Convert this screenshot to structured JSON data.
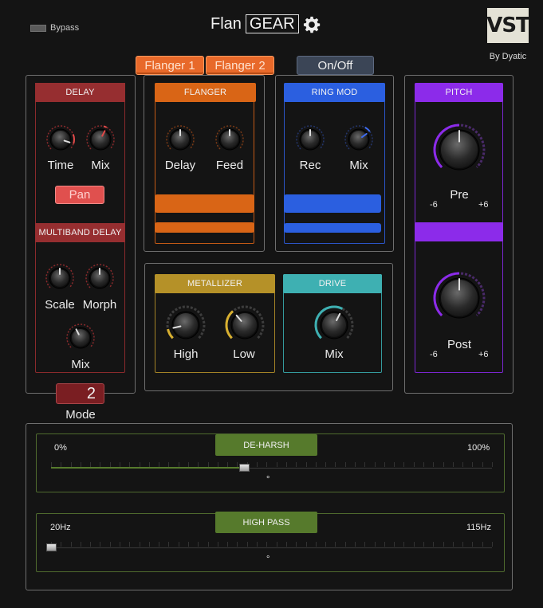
{
  "header": {
    "bypass_label": "Bypass",
    "title_plain": "Flan",
    "title_boxed": "GEAR",
    "logo_text": "VST",
    "by_label": "By Dyatic"
  },
  "tabs": [
    {
      "label": "Flanger 1",
      "active": true
    },
    {
      "label": "Flanger 2",
      "active": true
    },
    {
      "label": "On/Off",
      "active": false
    }
  ],
  "delay": {
    "title": "DELAY",
    "knobs": [
      {
        "label": "Time"
      },
      {
        "label": "Mix"
      }
    ],
    "pan_label": "Pan"
  },
  "multiband": {
    "title": "MULTIBAND DELAY",
    "knobs": [
      {
        "label": "Scale"
      },
      {
        "label": "Morph"
      },
      {
        "label": "Mix"
      }
    ]
  },
  "mode": {
    "value": "2",
    "label": "Mode"
  },
  "flanger": {
    "title": "FLANGER",
    "knobs": [
      {
        "label": "Delay"
      },
      {
        "label": "Feed"
      }
    ]
  },
  "ringmod": {
    "title": "RING MOD",
    "knobs": [
      {
        "label": "Rec"
      },
      {
        "label": "Mix"
      }
    ]
  },
  "pitch": {
    "title": "PITCH",
    "pre": {
      "label": "Pre",
      "min": "-6",
      "max": "+6"
    },
    "post": {
      "label": "Post",
      "min": "-6",
      "max": "+6"
    }
  },
  "metallizer": {
    "title": "METALLIZER",
    "knobs": [
      {
        "label": "High"
      },
      {
        "label": "Low"
      }
    ]
  },
  "drive": {
    "title": "DRIVE",
    "knobs": [
      {
        "label": "Mix"
      }
    ]
  },
  "deharsh": {
    "title": "DE-HARSH",
    "min_label": "0%",
    "max_label": "100%",
    "value_label": "°",
    "fraction": 0.44
  },
  "highpass": {
    "title": "HIGH PASS",
    "min_label": "20Hz",
    "max_label": "115Hz",
    "value_label": "°",
    "fraction": 0.0
  },
  "colors": {
    "delay": "#962e30",
    "flanger": "#d96516",
    "ringmod": "#2b5fe0",
    "pitch": "#8c2bea",
    "metallizer": "#b59128",
    "drive": "#3eb0b2",
    "slider": "#567a2c"
  }
}
